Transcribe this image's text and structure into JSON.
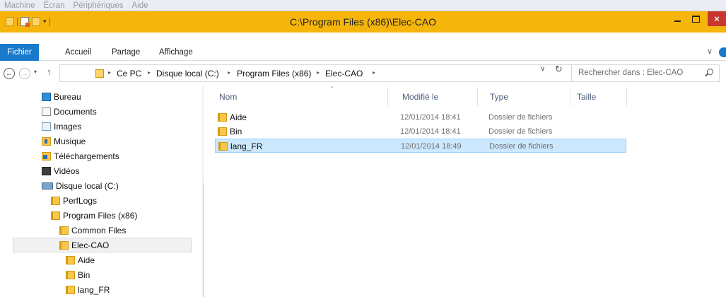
{
  "vm_menu": [
    "Machine",
    "Écran",
    "Périphériques",
    "Aide"
  ],
  "window": {
    "title": "C:\\Program Files (x86)\\Elec-CAO",
    "close_glyph": "×",
    "accent_color": "#f5b50a"
  },
  "ribbon": {
    "tabs": [
      "Fichier",
      "Accueil",
      "Partage",
      "Affichage"
    ],
    "expand_glyph": "∨"
  },
  "nav": {
    "back_glyph": "←",
    "forward_glyph": "→",
    "recent_glyph": "▾",
    "up_glyph": "↑"
  },
  "address": {
    "breadcrumb": [
      "Ce PC",
      "Disque local (C:)",
      "Program Files (x86)",
      "Elec-CAO"
    ],
    "separator": "▸",
    "dropdown_glyph": "∨",
    "refresh_glyph": "↻"
  },
  "search": {
    "placeholder": "Rechercher dans : Elec-CAO"
  },
  "tree": {
    "items": [
      {
        "label": "Bureau",
        "icon": "desktop-icon"
      },
      {
        "label": "Documents",
        "icon": "documents-icon"
      },
      {
        "label": "Images",
        "icon": "images-icon"
      },
      {
        "label": "Musique",
        "icon": "music-icon"
      },
      {
        "label": "Téléchargements",
        "icon": "downloads-icon"
      },
      {
        "label": "Vidéos",
        "icon": "videos-icon"
      },
      {
        "label": "Disque local (C:)",
        "icon": "drive-icon"
      },
      {
        "label": "PerfLogs",
        "icon": "folder-icon"
      },
      {
        "label": "Program Files (x86)",
        "icon": "folder-icon"
      },
      {
        "label": "Common Files",
        "icon": "folder-icon"
      },
      {
        "label": "Elec-CAO",
        "icon": "folder-icon",
        "selected": true
      },
      {
        "label": "Aide",
        "icon": "folder-icon"
      },
      {
        "label": "Bin",
        "icon": "folder-icon"
      },
      {
        "label": "lang_FR",
        "icon": "folder-icon"
      }
    ],
    "scroll_up_glyph": "^"
  },
  "files": {
    "columns": [
      "Nom",
      "Modifié le",
      "Type",
      "Taille"
    ],
    "sort_glyph": "^",
    "rows": [
      {
        "name": "Aide",
        "modified": "12/01/2014 18:41",
        "type": "Dossier de fichiers",
        "size": ""
      },
      {
        "name": "Bin",
        "modified": "12/01/2014 18:41",
        "type": "Dossier de fichiers",
        "size": ""
      },
      {
        "name": "lang_FR",
        "modified": "12/01/2014 18:49",
        "type": "Dossier de fichiers",
        "size": "",
        "selected": true
      }
    ],
    "selection_color": "#cce8ff"
  }
}
